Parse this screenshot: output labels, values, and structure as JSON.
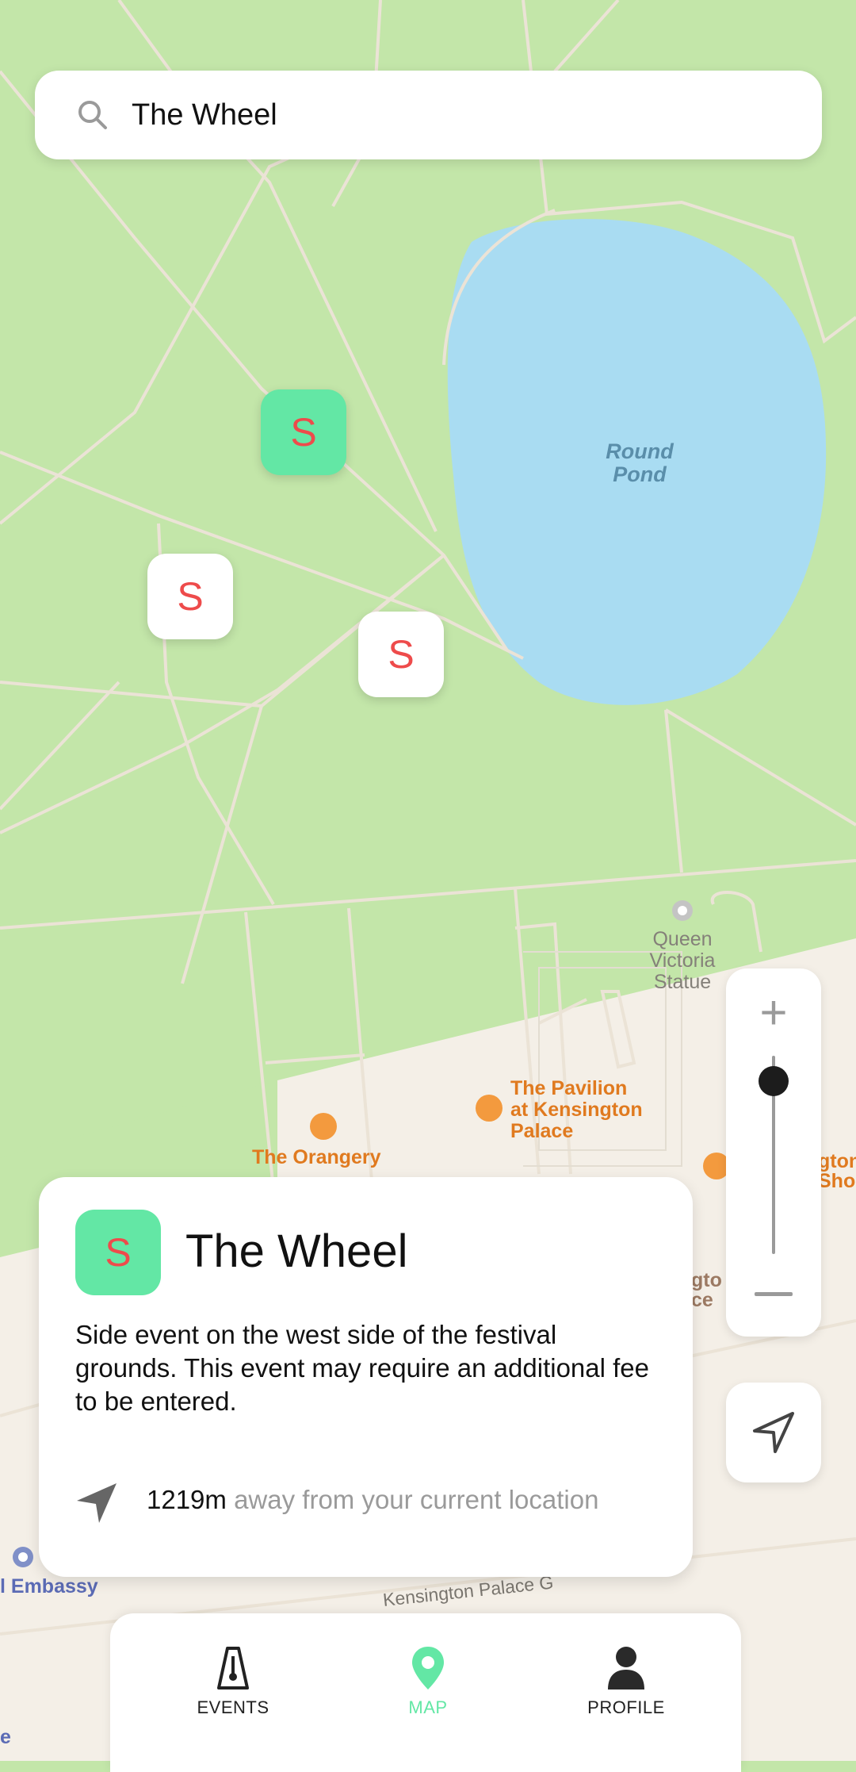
{
  "search": {
    "value": "The Wheel",
    "icon": "search-icon"
  },
  "map": {
    "labels": {
      "round_pond": [
        "Round",
        "Pond"
      ],
      "queen_victoria": [
        "Queen",
        "Victoria",
        "Statue"
      ],
      "pavilion": [
        "The Pavilion",
        "at Kensington",
        "Palace"
      ],
      "orangery": "The Orangery",
      "right_cut_top": [
        "gton",
        "Sho"
      ],
      "right_cut_mid": [
        "gto",
        "ce"
      ],
      "embassy": "l Embassy",
      "road": "Kensington Palace G",
      "bottom_e": "e"
    },
    "markers": [
      {
        "label": "S",
        "style": "green"
      },
      {
        "label": "S",
        "style": "white"
      },
      {
        "label": "S",
        "style": "white"
      }
    ]
  },
  "card": {
    "badge": "S",
    "title": "The Wheel",
    "description": "Side event on the west side of the festival grounds. This event may require an additional fee to be entered.",
    "distance_value": "1219m",
    "distance_text": " away from your current location"
  },
  "tabs": [
    {
      "label": "EVENTS",
      "icon": "metronome-icon",
      "active": false
    },
    {
      "label": "MAP",
      "icon": "map-pin-icon",
      "active": true
    },
    {
      "label": "PROFILE",
      "icon": "person-icon",
      "active": false
    }
  ],
  "colors": {
    "accent": "#63e7a5",
    "marker_letter": "#ee4b4b",
    "park": "#c3e6a9",
    "water": "#a9dcf2",
    "urban": "#f4efe7",
    "poi_orange": "#e07a1f",
    "embassy_blue": "#5b6bb5"
  }
}
